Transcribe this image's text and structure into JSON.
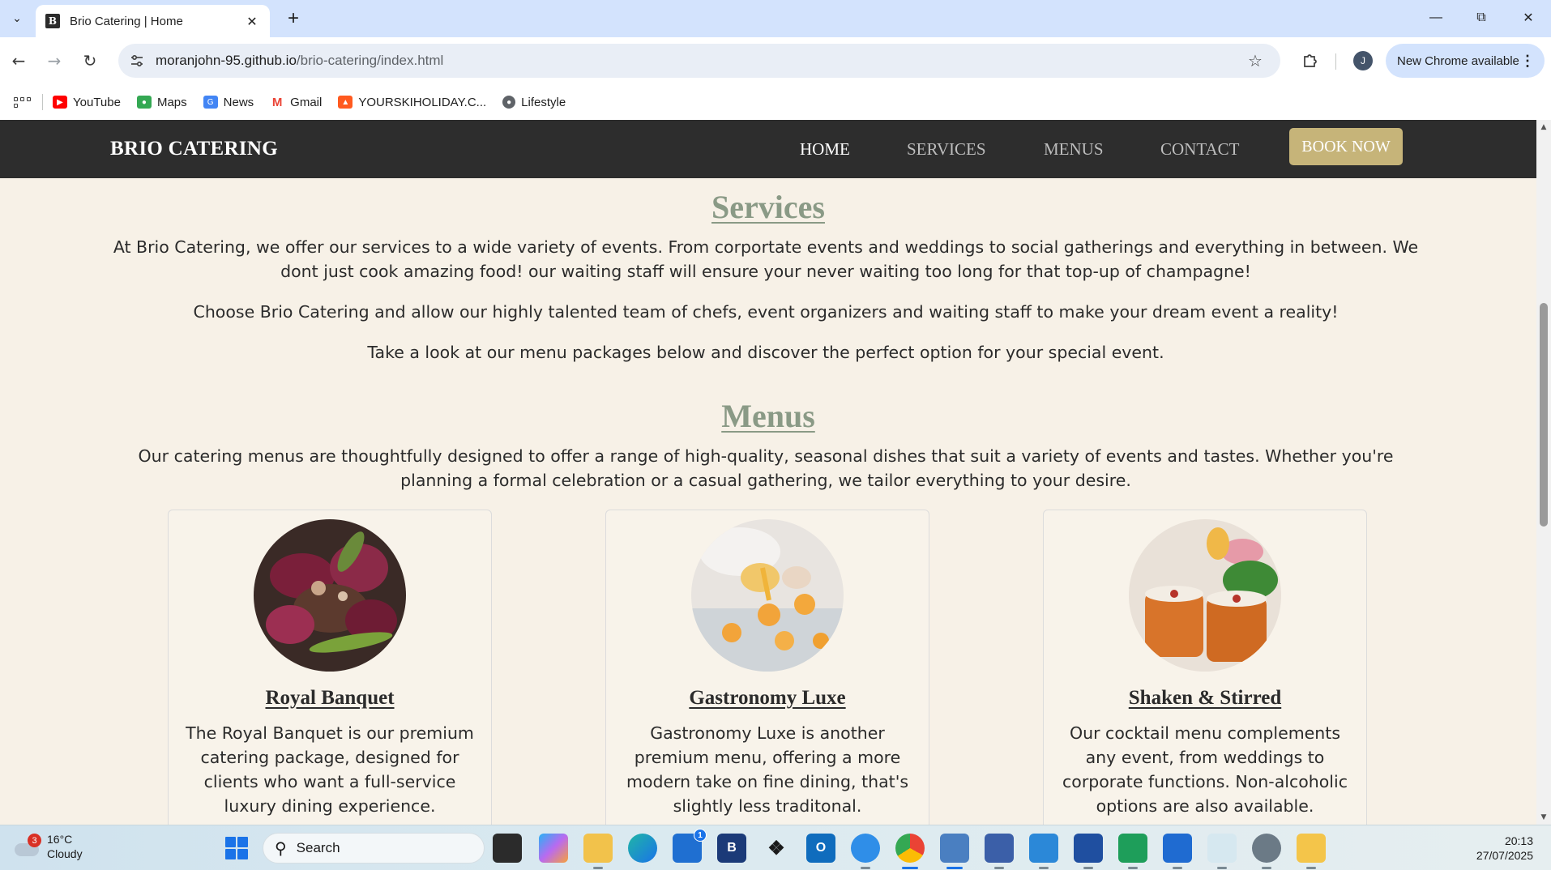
{
  "browser": {
    "tab_title": "Brio Catering | Home",
    "tab_favicon_letter": "B",
    "url_host": "moranjohn-95.github.io",
    "url_path": "/brio-catering/index.html",
    "update_label": "New Chrome available",
    "profile_initial": "J",
    "bookmarks": [
      {
        "label": "YouTube",
        "icon": "youtube-icon",
        "color": "#ff0000"
      },
      {
        "label": "Maps",
        "icon": "maps-icon",
        "color": "#34a853"
      },
      {
        "label": "News",
        "icon": "news-icon",
        "color": "#4285f4"
      },
      {
        "label": "Gmail",
        "icon": "gmail-icon",
        "color": "#ea4335"
      },
      {
        "label": "YOURSKIHOLIDAY.C...",
        "icon": "skiholiday-icon",
        "color": "#ff5a1f"
      },
      {
        "label": "Lifestyle",
        "icon": "globe-icon",
        "color": "#5f6368"
      }
    ]
  },
  "site": {
    "brand": "BRIO CATERING",
    "nav": [
      {
        "label": "HOME",
        "active": true
      },
      {
        "label": "SERVICES",
        "active": false
      },
      {
        "label": "MENUS",
        "active": false
      },
      {
        "label": "CONTACT",
        "active": false
      }
    ],
    "cta": "BOOK NOW",
    "colors": {
      "nav_bg": "#2d2d2d",
      "accent": "#c6b479",
      "heading": "#8a9a86",
      "page_bg": "#f7f1e7"
    },
    "services": {
      "title": "Services",
      "paragraphs": [
        "At Brio Catering, we offer our services to a wide variety of events. From corportate events and weddings to social gatherings and everything in between. We dont just cook amazing food! our waiting staff will ensure your never waiting too long for that top-up of champagne!",
        "Choose Brio Catering and allow our highly talented team of chefs, event organizers and waiting staff to make your dream event a reality!",
        "Take a look at our menu packages below and discover the perfect option for your special event."
      ]
    },
    "menus": {
      "title": "Menus",
      "intro": "Our catering menus are thoughtfully designed to offer a range of high-quality, seasonal dishes that suit a variety of events and tastes. Whether you're planning a formal celebration or a casual gathering, we tailor everything to your desire.",
      "cards": [
        {
          "title": "Royal Banquet",
          "text": "The Royal Banquet is our premium catering package, designed for clients who want a full-service luxury dining experience."
        },
        {
          "title": "Gastronomy Luxe",
          "text": "Gastronomy Luxe is another premium menu, offering a more modern take on fine dining, that's slightly less traditonal."
        },
        {
          "title": "Shaken & Stirred",
          "text": "Our cocktail menu complements any event, from weddings to corporate functions. Non-alcoholic options are also available."
        }
      ]
    }
  },
  "taskbar": {
    "weather_temp": "16°C",
    "weather_desc": "Cloudy",
    "weather_badge": "3",
    "search_placeholder": "Search",
    "time": "20:13",
    "date": "27/07/2025",
    "store_badge": "1"
  }
}
